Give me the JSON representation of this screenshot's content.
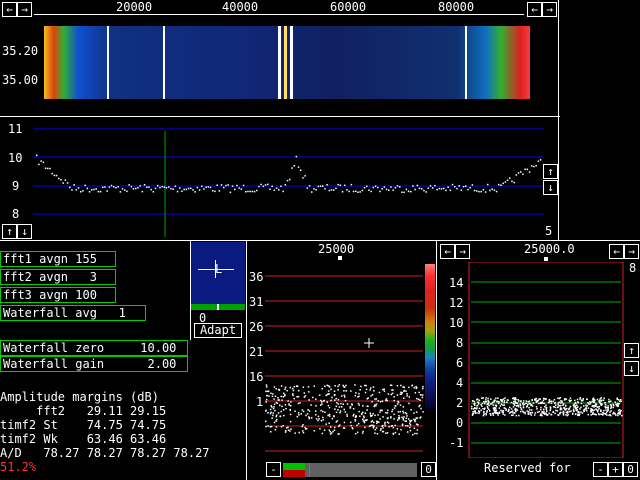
{
  "colors": {
    "accent_green": "#00cc00",
    "grid_blue": "#0000ff",
    "grid_red": "#d02020",
    "grid_green": "#00b000",
    "pct_red": "#ff3030"
  },
  "top": {
    "freq_ticks": [
      "20000",
      "40000",
      "60000",
      "80000"
    ],
    "waterfall_labels": [
      "35.20",
      "35.00"
    ],
    "nav_left": "←",
    "nav_right": "→",
    "nav_left2": "←",
    "nav_right2": "→"
  },
  "spectrum": {
    "y_ticks": [
      "11",
      "10",
      "9",
      "8"
    ],
    "up": "↑",
    "down": "↓",
    "right_up": "↑",
    "right_down": "↓",
    "right_value": "5"
  },
  "params": {
    "fft1_avgn": "fft1 avgn 155",
    "fft2_avgn": "fft2 avgn   3",
    "fft3_avgn": "fft3 avgn 100",
    "waterfall_avg": "Waterfall avg   1",
    "waterfall_zero": "Waterfall zero     10.00",
    "waterfall_gain": "Waterfall gain      2.00"
  },
  "margins": {
    "title": "Amplitude margins (dB)",
    "rows": [
      "     fft2   29.11 29.15",
      "timf2 St    74.75 74.75",
      "timf2 Wk    63.46 63.46",
      "A/D   78.27 78.27 78.27 78.27"
    ],
    "percent": "51.2%"
  },
  "agc": {
    "marker": "L",
    "value": "0",
    "adapt": "Adapt"
  },
  "mid": {
    "freq": "25000",
    "y_ticks": [
      "36",
      "31",
      "26",
      "21",
      "16",
      "1"
    ],
    "minus": "-",
    "zero": "0"
  },
  "right": {
    "freq": "25000.0",
    "left": "←",
    "right": "→",
    "left2": "←",
    "right2": "→",
    "y_ticks": [
      "14",
      "12",
      "10",
      "8",
      "6",
      "4",
      "2",
      "0",
      "-1"
    ],
    "top_value": "8",
    "up": "↑",
    "down": "↓",
    "reserved": "Reserved for",
    "minus": "-",
    "plus": "+",
    "zero": "0"
  }
}
